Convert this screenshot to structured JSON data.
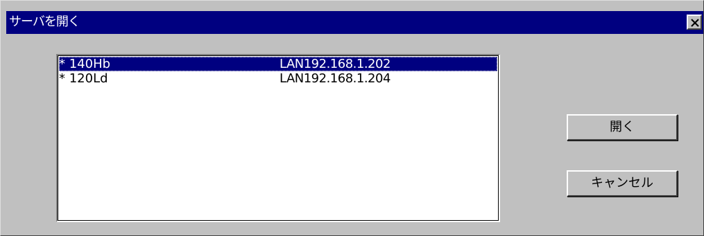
{
  "dialog": {
    "title": "サーバを開く",
    "close_icon": "close-x-icon"
  },
  "server_list": {
    "items": [
      {
        "name": "* 140Hb",
        "address": "LAN192.168.1.202",
        "selected": true
      },
      {
        "name": "* 120Ld",
        "address": "LAN192.168.1.204",
        "selected": false
      }
    ]
  },
  "buttons": {
    "open_label": "開く",
    "cancel_label": "キャンセル"
  },
  "colors": {
    "titlebar": "#000080",
    "face": "#c0c0c0",
    "selection": "#000080"
  }
}
